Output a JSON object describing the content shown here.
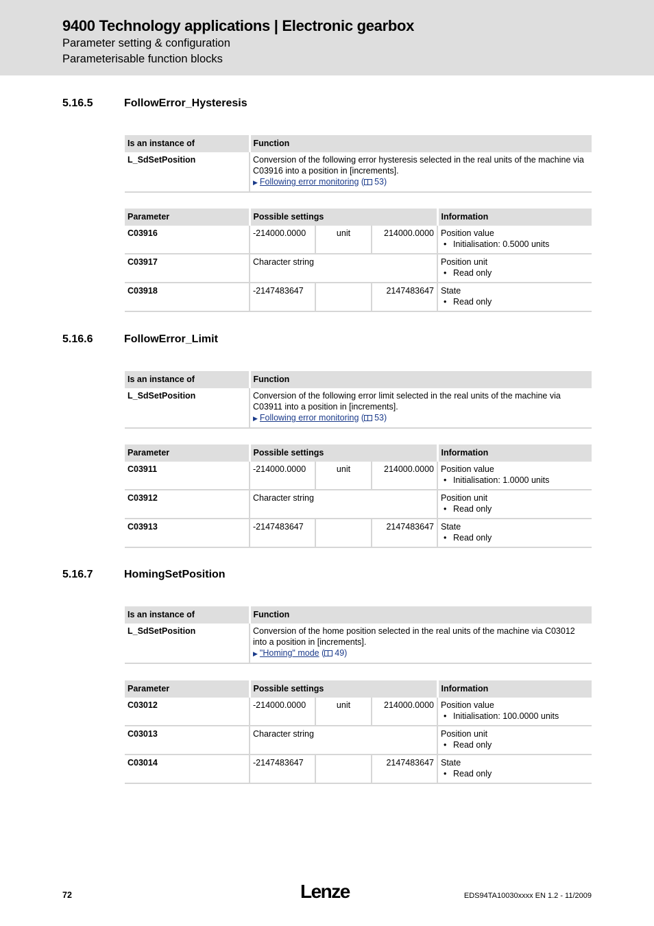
{
  "header": {
    "title": "9400 Technology applications | Electronic gearbox",
    "subtitle1": "Parameter setting & configuration",
    "subtitle2": "Parameterisable function blocks"
  },
  "sections": [
    {
      "number": "5.16.5",
      "title": "FollowError_Hysteresis",
      "instance_table": {
        "headers": [
          "Is an instance of",
          "Function"
        ],
        "instance": "L_SdSetPosition",
        "function_text": "Conversion of the following error hysteresis selected in the real units of the machine via C03916 into a position in [increments].",
        "link_text": "Following error monitoring",
        "link_open": "(",
        "link_page": "53)"
      },
      "param_table": {
        "headers": [
          "Parameter",
          "Possible settings",
          "Information"
        ],
        "rows": [
          {
            "param": "C03916",
            "min": "-214000.0000",
            "unit": "unit",
            "max": "214000.0000",
            "info": "Position value",
            "bullet": "Initialisation: 0.5000 units"
          },
          {
            "param": "C03917",
            "setting": "Character string",
            "info": "Position unit",
            "bullet": "Read only"
          },
          {
            "param": "C03918",
            "min": "-2147483647",
            "unit": "",
            "max": "2147483647",
            "info": "State",
            "bullet": "Read only"
          }
        ]
      }
    },
    {
      "number": "5.16.6",
      "title": "FollowError_Limit",
      "instance_table": {
        "headers": [
          "Is an instance of",
          "Function"
        ],
        "instance": "L_SdSetPosition",
        "function_text": "Conversion of the following error limit selected in the real units of the machine via C03911 into a position in [increments].",
        "link_text": "Following error monitoring",
        "link_open": "(",
        "link_page": "53)"
      },
      "param_table": {
        "headers": [
          "Parameter",
          "Possible settings",
          "Information"
        ],
        "rows": [
          {
            "param": "C03911",
            "min": "-214000.0000",
            "unit": "unit",
            "max": "214000.0000",
            "info": "Position value",
            "bullet": "Initialisation: 1.0000 units"
          },
          {
            "param": "C03912",
            "setting": "Character string",
            "info": "Position unit",
            "bullet": "Read only"
          },
          {
            "param": "C03913",
            "min": "-2147483647",
            "unit": "",
            "max": "2147483647",
            "info": "State",
            "bullet": "Read only"
          }
        ]
      }
    },
    {
      "number": "5.16.7",
      "title": "HomingSetPosition",
      "instance_table": {
        "headers": [
          "Is an instance of",
          "Function"
        ],
        "instance": "L_SdSetPosition",
        "function_text": "Conversion of the home position selected in the real units of the machine via C03012 into a position in [increments].",
        "link_text": "\"Homing\" mode",
        "link_open": "(",
        "link_page": "49)"
      },
      "param_table": {
        "headers": [
          "Parameter",
          "Possible settings",
          "Information"
        ],
        "rows": [
          {
            "param": "C03012",
            "min": "-214000.0000",
            "unit": "unit",
            "max": "214000.0000",
            "info": "Position value",
            "bullet": "Initialisation: 100.0000 units"
          },
          {
            "param": "C03013",
            "setting": "Character string",
            "info": "Position unit",
            "bullet": "Read only"
          },
          {
            "param": "C03014",
            "min": "-2147483647",
            "unit": "",
            "max": "2147483647",
            "info": "State",
            "bullet": "Read only"
          }
        ]
      }
    }
  ],
  "footer": {
    "page": "72",
    "logo": "Lenze",
    "doc_ref": "EDS94TA10030xxxx EN 1.2 - 11/2009"
  }
}
